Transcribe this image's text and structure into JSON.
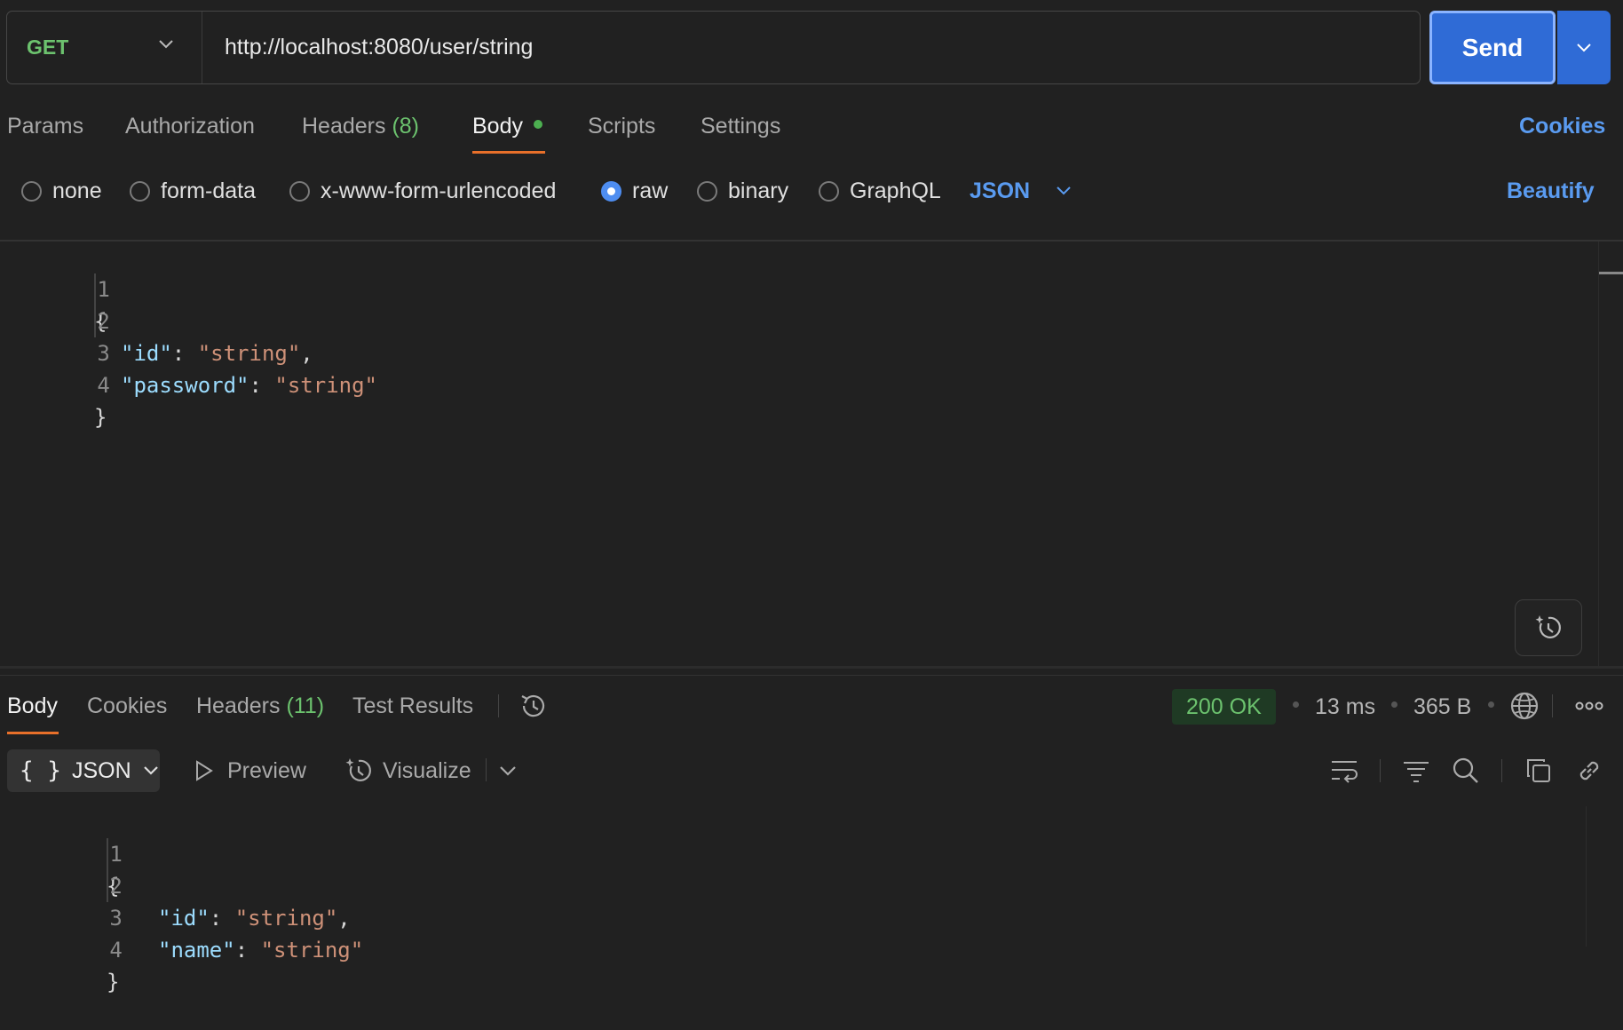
{
  "request": {
    "method": "GET",
    "url": "http://localhost:8080/user/string",
    "send_label": "Send"
  },
  "request_tabs": {
    "params": "Params",
    "authorization": "Authorization",
    "headers": "Headers",
    "headers_count": "(8)",
    "body": "Body",
    "scripts": "Scripts",
    "settings": "Settings",
    "cookies": "Cookies"
  },
  "body_types": {
    "none": "none",
    "form_data": "form-data",
    "urlencoded": "x-www-form-urlencoded",
    "raw": "raw",
    "binary": "binary",
    "graphql": "GraphQL",
    "selected": "raw",
    "language": "JSON",
    "beautify": "Beautify"
  },
  "request_body": {
    "line_numbers": [
      "1",
      "2",
      "3",
      "4"
    ],
    "open_brace": "{",
    "close_brace": "}",
    "fields": [
      {
        "key": "\"id\"",
        "value": "\"string\"",
        "trail": ","
      },
      {
        "key": "\"password\"",
        "value": "\"string\"",
        "trail": ""
      }
    ]
  },
  "response_tabs": {
    "body": "Body",
    "cookies": "Cookies",
    "headers": "Headers",
    "headers_count": "(11)",
    "test_results": "Test Results"
  },
  "response_meta": {
    "status": "200 OK",
    "time": "13 ms",
    "size": "365 B"
  },
  "response_toolbar": {
    "format": "JSON",
    "preview": "Preview",
    "visualize": "Visualize"
  },
  "response_body": {
    "line_numbers": [
      "1",
      "2",
      "3",
      "4"
    ],
    "open_brace": "{",
    "close_brace": "}",
    "fields": [
      {
        "key": "\"id\"",
        "value": "\"string\"",
        "trail": ","
      },
      {
        "key": "\"name\"",
        "value": "\"string\"",
        "trail": ""
      }
    ]
  },
  "colors": {
    "background": "#212121",
    "accent_blue": "#2f6bd6",
    "link_blue": "#5a9bf0",
    "method_green": "#6cc26e",
    "tab_underline": "#e8702a",
    "json_key": "#9cdcfe",
    "json_string": "#ce9178"
  }
}
